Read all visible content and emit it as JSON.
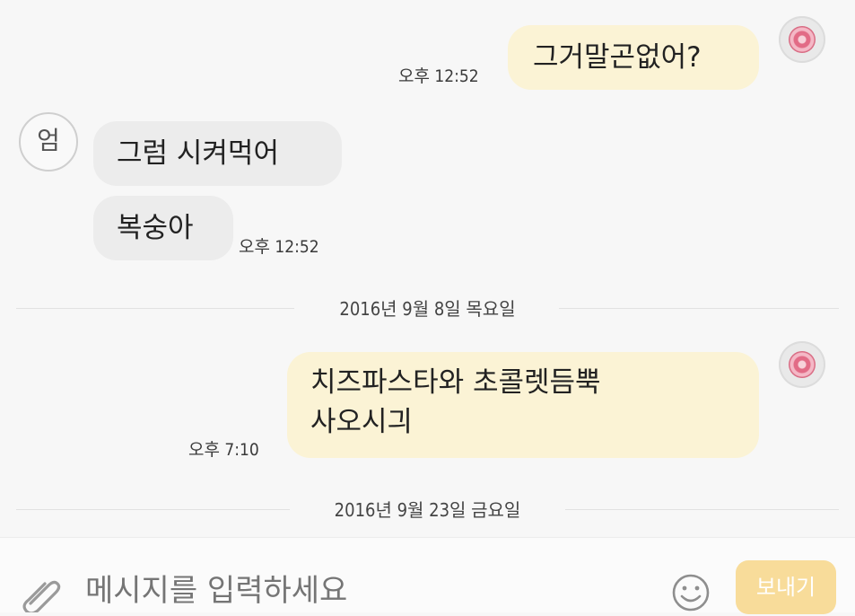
{
  "messages": {
    "m1": {
      "text": "그거말곤없어?",
      "time": "오후 12:52"
    },
    "m2": {
      "text": "그럼 시켜먹어"
    },
    "m3": {
      "text": "복숭아",
      "time": "오후 12:52"
    },
    "m4": {
      "line1": "치즈파스타와 초콜렛듬뿍",
      "line2": "사오시긔",
      "time": "오후 7:10"
    }
  },
  "sender": {
    "avatar_label": "엄"
  },
  "dividers": {
    "d1": "2016년 9월 8일 목요일",
    "d2": "2016년 9월 23일 금요일"
  },
  "input": {
    "placeholder": "메시지를 입력하세요",
    "send_label": "보내기"
  },
  "colors": {
    "my_bubble": "#fbf3d5",
    "their_bubble": "#ececec",
    "send_button": "#f8dc9a"
  }
}
